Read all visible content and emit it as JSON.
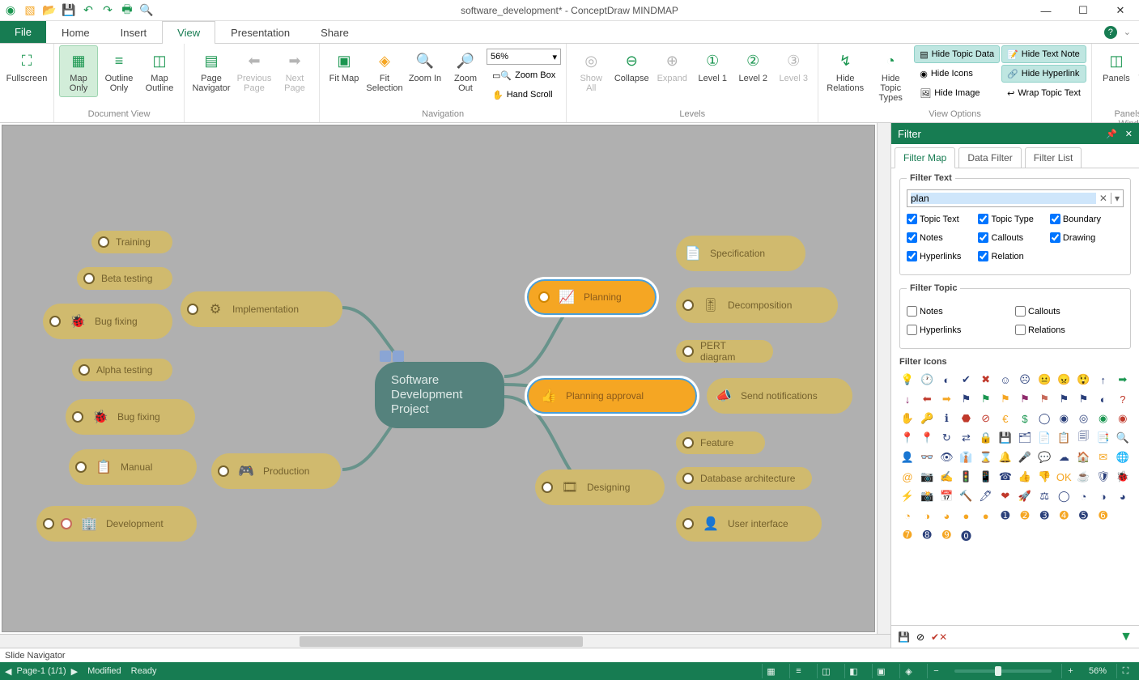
{
  "window": {
    "title": "software_development* - ConceptDraw MINDMAP"
  },
  "menu": {
    "file": "File",
    "tabs": [
      "Home",
      "Insert",
      "View",
      "Presentation",
      "Share"
    ],
    "active_tab": "View"
  },
  "ribbon": {
    "fullscreen": "Fullscreen",
    "map_only": "Map Only",
    "outline_only": "Outline Only",
    "map_outline": "Map Outline",
    "page_navigator": "Page Navigator",
    "previous_page": "Previous Page",
    "next_page": "Next Page",
    "fit_map": "Fit Map",
    "fit_selection": "Fit Selection",
    "zoom_in": "Zoom In",
    "zoom_out": "Zoom Out",
    "zoom_value": "56%",
    "zoom_box": "Zoom Box",
    "hand_scroll": "Hand Scroll",
    "show_all": "Show All",
    "collapse": "Collapse",
    "expand": "Expand",
    "level1": "Level 1",
    "level2": "Level 2",
    "level3": "Level 3",
    "hide_relations": "Hide Relations",
    "hide_topic_types": "Hide Topic Types",
    "hide_topic_data": "Hide Topic Data",
    "hide_text_note": "Hide Text Note",
    "hide_icons": "Hide Icons",
    "hide_hyperlink": "Hide Hyperlink",
    "hide_image": "Hide Image",
    "wrap_topic_text": "Wrap Topic Text",
    "panels": "Panels",
    "windows": "Windows",
    "groups": {
      "document_view": "Document View",
      "navigation": "Navigation",
      "levels": "Levels",
      "view_options": "View Options",
      "panels_windows": "Panels and Windows"
    }
  },
  "map": {
    "center": "Software Development Project",
    "left": {
      "implementation": "Implementation",
      "production": "Production",
      "training": "Training",
      "beta_testing": "Beta testing",
      "bug_fixing": "Bug fixing",
      "alpha_testing": "Alpha testing",
      "bug_fixing2": "Bug fixing",
      "manual": "Manual",
      "development": "Development"
    },
    "right": {
      "planning": "Planning",
      "planning_approval": "Planning approval",
      "designing": "Designing",
      "specification": "Specification",
      "decomposition": "Decomposition",
      "pert": "PERT diagram",
      "send_notifications": "Send notifications",
      "feature": "Feature",
      "db_arch": "Database architecture",
      "user_interface": "User interface"
    }
  },
  "filter_panel": {
    "title": "Filter",
    "tabs": {
      "map": "Filter Map",
      "data": "Data Filter",
      "list": "Filter List"
    },
    "filter_text_legend": "Filter Text",
    "filter_topic_legend": "Filter Topic",
    "filter_icons_legend": "Filter Icons",
    "input_value": "plan",
    "text_checks": {
      "topic_text": "Topic Text",
      "topic_type": "Topic Type",
      "boundary": "Boundary",
      "notes": "Notes",
      "callouts": "Callouts",
      "drawing": "Drawing",
      "hyperlinks": "Hyperlinks",
      "relation": "Relation"
    },
    "topic_checks": {
      "notes": "Notes",
      "callouts": "Callouts",
      "hyperlinks": "Hyperlinks",
      "relations": "Relations"
    }
  },
  "slide_navigator": "Slide Navigator",
  "status": {
    "page": "Page-1 (1/1)",
    "modified": "Modified",
    "ready": "Ready",
    "zoom": "56%"
  }
}
